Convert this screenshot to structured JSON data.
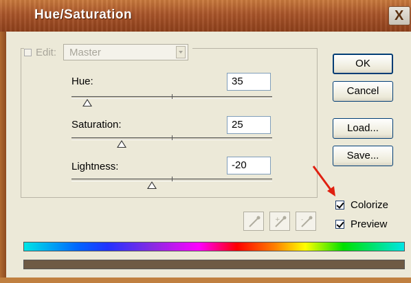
{
  "window": {
    "title": "Hue/Saturation",
    "close_glyph": "X"
  },
  "edit": {
    "label": "Edit:",
    "value": "Master"
  },
  "sliders": [
    {
      "label": "Hue:",
      "value": "35",
      "thumb_fraction": 0.08
    },
    {
      "label": "Saturation:",
      "value": "25",
      "thumb_fraction": 0.25
    },
    {
      "label": "Lightness:",
      "value": "-20",
      "thumb_fraction": 0.4
    }
  ],
  "buttons": {
    "ok": "OK",
    "cancel": "Cancel",
    "load": "Load...",
    "save": "Save..."
  },
  "options": {
    "colorize": {
      "label": "Colorize",
      "checked": true
    },
    "preview": {
      "label": "Preview",
      "checked": true
    }
  },
  "tools": [
    "eyedropper-icon",
    "eyedropper-plus-icon",
    "eyedropper-minus-icon"
  ],
  "colors": {
    "annotation_arrow": "#e02010",
    "result_bar": "#6e5a44"
  }
}
